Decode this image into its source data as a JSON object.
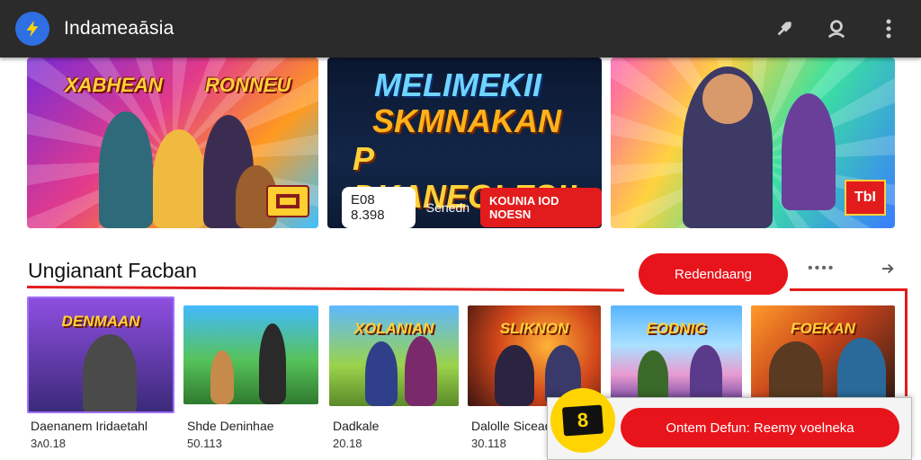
{
  "topbar": {
    "title": "Indameaāsia",
    "logo_icon": "lightning-icon",
    "actions": [
      "rocket-icon",
      "profile-icon",
      "more-vertical-icon"
    ],
    "bar_color": "#2b2b2b",
    "logo_color": "#2f6fe4"
  },
  "banners": [
    {
      "title_left": "XABHEAN",
      "title_right": "RONNEU",
      "badge": ""
    },
    {
      "line1": "MELIMEKII",
      "line2": "SKMNAKAN",
      "line3": "P DKANEOLES!!",
      "price": "E08 8.398",
      "label": "Senedn",
      "promo": "KOUNIA IOD NOESN"
    },
    {
      "badge": "ТbI"
    }
  ],
  "section": {
    "title": "Ungianant Facban",
    "see_all_label": "Redendaang",
    "more_label": "••••",
    "accent": "#e8141c"
  },
  "cards": [
    {
      "thumb_title": "DENMAAN",
      "name": "Daenanem Iridaetahl",
      "meta": "3ᴧ0.18"
    },
    {
      "thumb_title": "",
      "name": "Shde Deninhae",
      "meta": "50.113"
    },
    {
      "thumb_title": "XOLANIAN",
      "name": "Dadkale",
      "meta": "20.18"
    },
    {
      "thumb_title": "SLIKNON",
      "name": "Dalolle Sicead",
      "meta": "30.118"
    },
    {
      "thumb_title": "EODNIG",
      "name": "",
      "meta": ""
    },
    {
      "thumb_title": "FOEKAN",
      "name": "",
      "meta": ""
    }
  ],
  "snackbar": {
    "coin_label": "8",
    "button_label": "Ontem Defun: Reemy voelneka"
  }
}
